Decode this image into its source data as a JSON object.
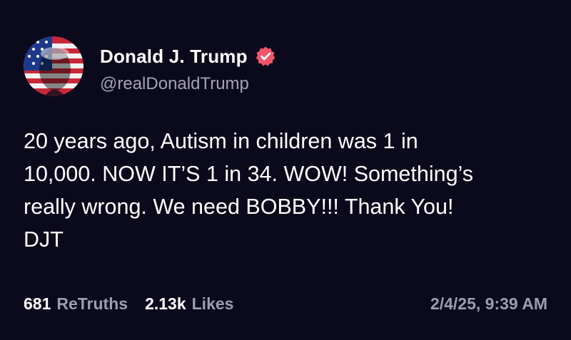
{
  "author": {
    "display_name": "Donald J. Trump",
    "handle": "@realDonaldTrump",
    "avatar_icon": "flag-portrait-avatar",
    "verified_icon": "verified-badge-icon",
    "verified_color": "#f0566a"
  },
  "post": {
    "text": "20 years ago, Autism in children was 1 in\n10,000. NOW IT’S 1 in 34. WOW! Something’s\nreally wrong. We need BOBBY!!! Thank You!\nDJT"
  },
  "stats": {
    "retruths_count": "681",
    "retruths_label": "ReTruths",
    "likes_count": "2.13k",
    "likes_label": "Likes"
  },
  "timestamp": "2/4/25, 9:39 AM",
  "colors": {
    "background": "#0b0a1c",
    "text_primary": "#ffffff",
    "text_secondary": "#9e9db0"
  }
}
